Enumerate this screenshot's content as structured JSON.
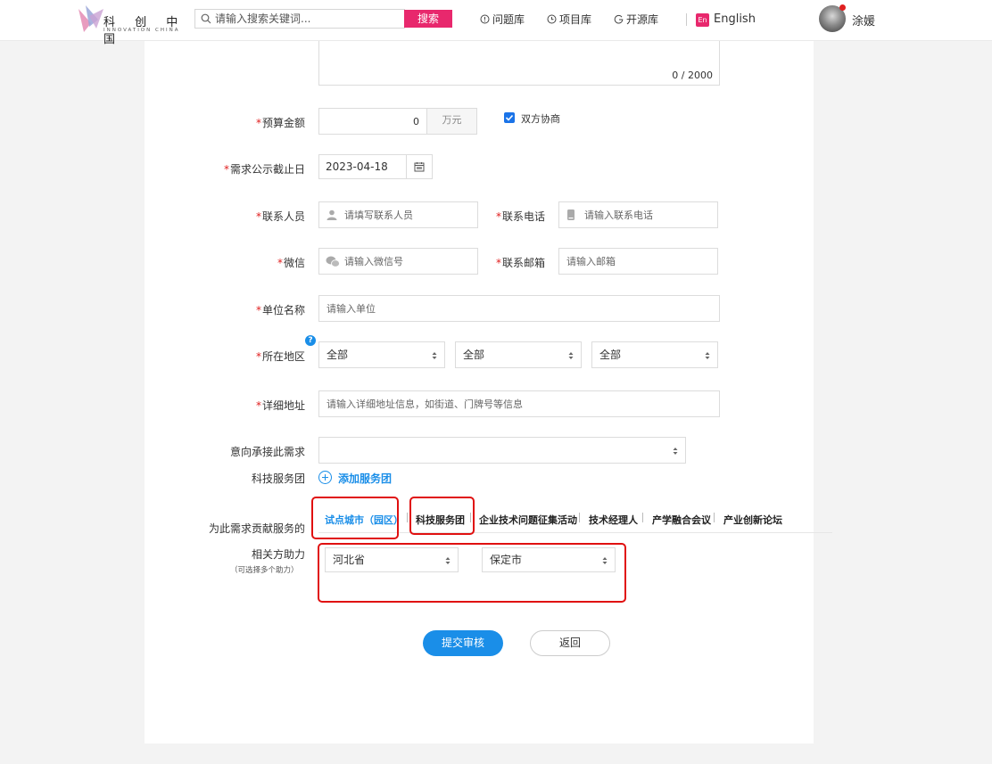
{
  "header": {
    "logo_cn": "科 创 中 国",
    "logo_en": "INNOVATION CHINA",
    "search_placeholder": "请输入搜索关键词...",
    "search_button": "搜索",
    "nav": [
      "问题库",
      "项目库",
      "开源库"
    ],
    "lang_badge": "En",
    "lang_label": "English",
    "username": "涂媛"
  },
  "form": {
    "description_count": "0 / 2000",
    "budget": {
      "label": "预算金额",
      "value": "0",
      "unit": "万元",
      "negotiable_label": "双方协商",
      "negotiable_checked": true
    },
    "deadline": {
      "label": "需求公示截止日",
      "value": "2023-04-18"
    },
    "contact_person": {
      "label": "联系人员",
      "placeholder": "请填写联系人员"
    },
    "contact_phone": {
      "label": "联系电话",
      "placeholder": "请输入联系电话"
    },
    "wechat": {
      "label": "微信",
      "placeholder": "请输入微信号"
    },
    "email": {
      "label": "联系邮箱",
      "placeholder": "请输入邮箱"
    },
    "org_name": {
      "label": "单位名称",
      "placeholder": "请输入单位"
    },
    "region": {
      "label": "所在地区",
      "help": "?",
      "selects": [
        "全部",
        "全部",
        "全部"
      ]
    },
    "address": {
      "label": "详细地址",
      "placeholder": "请输入详细地址信息，如街道、门牌号等信息"
    },
    "intent": {
      "label": "意向承接此需求",
      "value": ""
    },
    "service_team": {
      "label": "科技服务团",
      "add_label": "添加服务团"
    },
    "contribute": {
      "label": "为此需求贡献服务的",
      "tabs": [
        "试点城市（园区）",
        "科技服务团",
        "企业技术问题征集活动",
        "技术经理人",
        "产学融合会议",
        "产业创新论坛"
      ],
      "active_tab": 0
    },
    "assist": {
      "label": "相关方助力",
      "note": "（可选择多个助力）",
      "province": "河北省",
      "city": "保定市"
    },
    "submit_label": "提交审核",
    "back_label": "返回"
  },
  "colors": {
    "accent": "#1a8ee8",
    "brand": "#e8286d",
    "required": "#e02020",
    "highlight": "#e01010"
  }
}
